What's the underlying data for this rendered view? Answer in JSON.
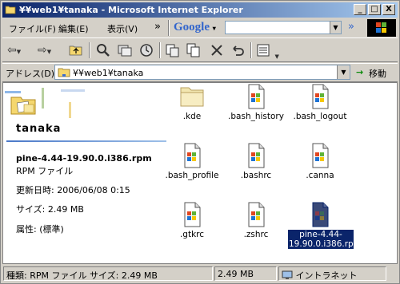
{
  "window": {
    "title": "¥¥web1¥tanaka - Microsoft Internet Explorer"
  },
  "title_buttons": {
    "minimize": "_",
    "maximize": "□",
    "close": "X"
  },
  "menu": {
    "file": "ファイル(F)",
    "edit": "編集(E)",
    "view": "表示(V)",
    "chevrons": "»"
  },
  "google": {
    "logo": "Google",
    "dropdown": "▾",
    "search_value": "",
    "chevron": "»"
  },
  "toolbar": {
    "back": "⇦",
    "forward": "⇨",
    "up": "⬑",
    "search": "🔍",
    "folders": "⧉",
    "history": "◷",
    "move_to": "⎘",
    "copy_to": "⎘",
    "delete": "✕",
    "undo": "↶",
    "views": "▦"
  },
  "address": {
    "label": "アドレス(D)",
    "value": "¥¥web1¥tanaka",
    "go_arrow": "→",
    "go_label": "移動"
  },
  "left_pane": {
    "folder_name": "tanaka",
    "selected_name": "pine-4.44-19.90.0.i386.rpm",
    "selected_type": "RPM ファイル",
    "modified": "更新日時: 2006/06/08 0:15",
    "size": "サイズ: 2.49 MB",
    "attributes": "属性: (標準)"
  },
  "files": [
    {
      "name": ".kde",
      "kind": "folder"
    },
    {
      "name": ".bash_history",
      "kind": "file"
    },
    {
      "name": ".bash_logout",
      "kind": "file"
    },
    {
      "name": ".bash_profile",
      "kind": "file"
    },
    {
      "name": ".bashrc",
      "kind": "file"
    },
    {
      "name": ".canna",
      "kind": "file"
    },
    {
      "name": ".gtkrc",
      "kind": "file"
    },
    {
      "name": ".zshrc",
      "kind": "file"
    },
    {
      "name": "pine-4.44-19.90.0.i386.rpm",
      "kind": "file",
      "selected": true
    }
  ],
  "status": {
    "details": "種類: RPM ファイル サイズ: 2.49 MB",
    "size": "2.49 MB",
    "zone": "イントラネット"
  },
  "colors": {
    "titlebar_start": "#0a246a",
    "titlebar_end": "#a6caf0",
    "selection": "#0a246a",
    "chrome": "#d4d0c8"
  }
}
